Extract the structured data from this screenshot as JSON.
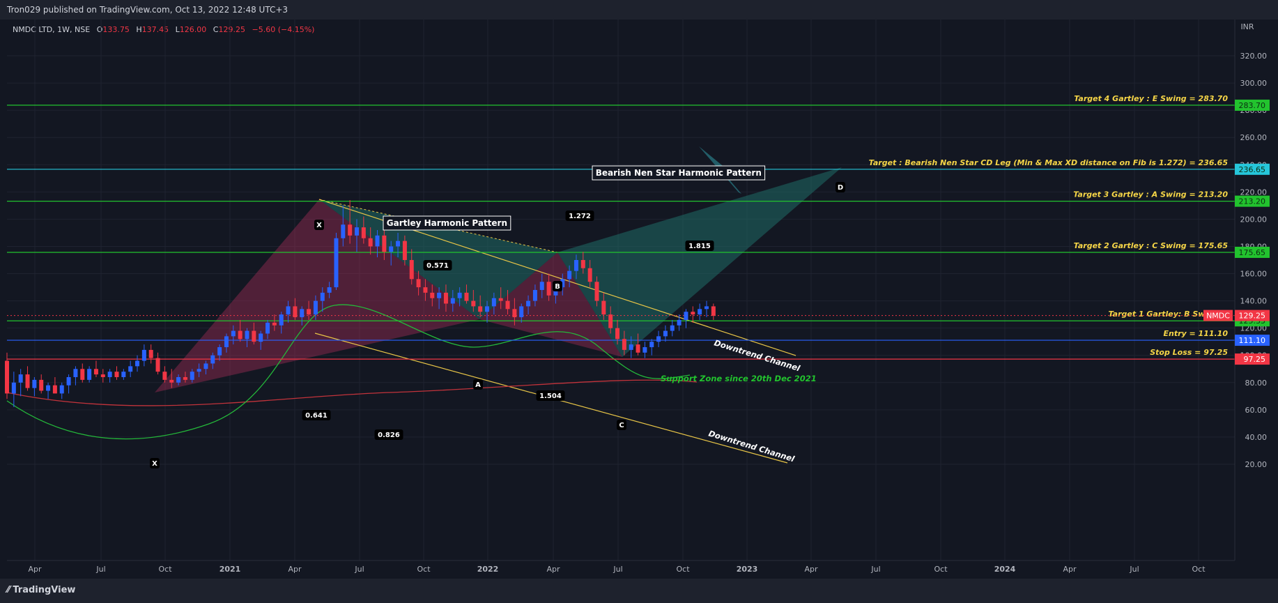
{
  "header": {
    "published_text": "Tron029 published on TradingView.com, Oct 13, 2022 12:48 UTC+3"
  },
  "footer": {
    "brand": "TradingView"
  },
  "symbol_bar": {
    "name": "NMDC LTD, 1W, NSE",
    "o_key": "O",
    "o": "133.75",
    "h_key": "H",
    "h": "137.45",
    "l_key": "L",
    "l": "126.00",
    "c_key": "C",
    "c": "129.25",
    "change": "−5.60 (−4.15%)"
  },
  "colors": {
    "up": "#2962ff",
    "down": "#f23645",
    "green_line": "#22c32e",
    "sma_green": "#24b83a",
    "sma_red": "#c2333b",
    "cyan": "#26c6da",
    "entry_blue": "#2962ff"
  },
  "chart_data": {
    "type": "candlestick",
    "currency": "INR",
    "y_ticks": [
      "320.00",
      "300.00",
      "280.00",
      "260.00",
      "240.00",
      "220.00",
      "200.00",
      "180.00",
      "160.00",
      "140.00",
      "120.00",
      "100.00",
      "80.00",
      "60.00",
      "40.00",
      "20.00"
    ],
    "x_ticks": [
      "Apr",
      "Jul",
      "Oct",
      "2021",
      "Apr",
      "Jul",
      "Oct",
      "2022",
      "Apr",
      "Jul",
      "Oct",
      "2023",
      "Apr",
      "Jul",
      "Oct",
      "2024",
      "Apr",
      "Jul",
      "Oct"
    ],
    "ylim": [
      8,
      340
    ],
    "horizontal_levels": [
      {
        "label": "Target 4 Gartley : E Swing = 283.70",
        "price": 283.7,
        "tag": "283.70",
        "color": "#22c32e"
      },
      {
        "label": "Target : Bearish Nen Star CD Leg (Min & Max XD distance on Fib is 1.272) = 236.65",
        "price": 236.65,
        "tag": "236.65",
        "color": "#26c6da"
      },
      {
        "label": "Target 3 Gartley : A Swing = 213.20",
        "price": 213.2,
        "tag": "213.20",
        "color": "#22c32e"
      },
      {
        "label": "Target 2 Gartley : C Swing = 175.65",
        "price": 175.65,
        "tag": "175.65",
        "color": "#22c32e"
      },
      {
        "label": "Target 1 Gartley: B Swing =",
        "price": 125.35,
        "tag": "125.35",
        "color": "#22c32e"
      },
      {
        "label": "Entry = 111.10",
        "price": 111.1,
        "tag": "111.10",
        "color": "#2962ff"
      },
      {
        "label": "Stop Loss = 97.25",
        "price": 97.25,
        "tag": "97.25",
        "color": "#f23645"
      }
    ],
    "last_price": {
      "symbol": "NMDC",
      "price": 129.25,
      "tag": "129.25"
    },
    "annotations": {
      "gartley_title": "Gartley Harmonic Pattern",
      "nenstar_title": "Bearish Nen Star Harmonic Pattern",
      "support_zone": "Support Zone since 20th Dec 2021",
      "channel_upper": "Downtrend Channel",
      "channel_lower": "Downtrend Channel",
      "points": [
        "X",
        "X",
        "A",
        "B",
        "C",
        "D"
      ],
      "fib_labels": [
        "0.571",
        "0.641",
        "0.826",
        "1.504",
        "1.272",
        "1.815"
      ]
    },
    "candles": [
      [
        96,
        102,
        68,
        72
      ],
      [
        72,
        88,
        62,
        80
      ],
      [
        80,
        90,
        70,
        86
      ],
      [
        86,
        92,
        74,
        76
      ],
      [
        76,
        84,
        70,
        82
      ],
      [
        82,
        86,
        72,
        74
      ],
      [
        74,
        80,
        68,
        78
      ],
      [
        78,
        84,
        72,
        72
      ],
      [
        72,
        80,
        68,
        78
      ],
      [
        78,
        86,
        72,
        84
      ],
      [
        84,
        92,
        78,
        90
      ],
      [
        90,
        94,
        80,
        82
      ],
      [
        82,
        92,
        80,
        90
      ],
      [
        90,
        96,
        84,
        86
      ],
      [
        86,
        90,
        80,
        84
      ],
      [
        84,
        90,
        80,
        88
      ],
      [
        88,
        92,
        82,
        84
      ],
      [
        84,
        90,
        82,
        88
      ],
      [
        88,
        96,
        84,
        92
      ],
      [
        92,
        100,
        88,
        96
      ],
      [
        96,
        108,
        92,
        104
      ],
      [
        104,
        108,
        94,
        98
      ],
      [
        98,
        102,
        86,
        88
      ],
      [
        88,
        92,
        80,
        82
      ],
      [
        82,
        90,
        76,
        80
      ],
      [
        80,
        86,
        78,
        84
      ],
      [
        84,
        88,
        80,
        82
      ],
      [
        82,
        90,
        80,
        88
      ],
      [
        88,
        94,
        84,
        90
      ],
      [
        90,
        96,
        86,
        94
      ],
      [
        94,
        102,
        90,
        100
      ],
      [
        100,
        108,
        96,
        106
      ],
      [
        106,
        116,
        102,
        114
      ],
      [
        114,
        122,
        108,
        118
      ],
      [
        118,
        126,
        110,
        112
      ],
      [
        112,
        120,
        106,
        118
      ],
      [
        118,
        124,
        108,
        110
      ],
      [
        110,
        118,
        104,
        116
      ],
      [
        116,
        126,
        112,
        124
      ],
      [
        124,
        130,
        118,
        122
      ],
      [
        122,
        132,
        116,
        130
      ],
      [
        130,
        140,
        124,
        136
      ],
      [
        136,
        142,
        126,
        128
      ],
      [
        128,
        136,
        122,
        134
      ],
      [
        134,
        140,
        126,
        130
      ],
      [
        130,
        144,
        126,
        140
      ],
      [
        140,
        150,
        132,
        146
      ],
      [
        146,
        154,
        142,
        150
      ],
      [
        150,
        190,
        148,
        186
      ],
      [
        186,
        210,
        180,
        196
      ],
      [
        196,
        214,
        182,
        188
      ],
      [
        188,
        200,
        176,
        194
      ],
      [
        194,
        202,
        182,
        186
      ],
      [
        186,
        194,
        174,
        180
      ],
      [
        180,
        192,
        172,
        188
      ],
      [
        188,
        194,
        170,
        176
      ],
      [
        176,
        184,
        166,
        180
      ],
      [
        180,
        190,
        172,
        184
      ],
      [
        184,
        188,
        166,
        170
      ],
      [
        170,
        178,
        152,
        156
      ],
      [
        156,
        162,
        144,
        150
      ],
      [
        150,
        156,
        140,
        146
      ],
      [
        146,
        152,
        136,
        142
      ],
      [
        142,
        150,
        134,
        146
      ],
      [
        146,
        152,
        132,
        138
      ],
      [
        138,
        148,
        132,
        142
      ],
      [
        142,
        150,
        136,
        146
      ],
      [
        146,
        152,
        138,
        140
      ],
      [
        140,
        148,
        132,
        136
      ],
      [
        136,
        144,
        128,
        132
      ],
      [
        132,
        140,
        124,
        136
      ],
      [
        136,
        146,
        130,
        142
      ],
      [
        142,
        150,
        134,
        140
      ],
      [
        140,
        148,
        130,
        134
      ],
      [
        134,
        142,
        122,
        128
      ],
      [
        128,
        138,
        124,
        136
      ],
      [
        136,
        144,
        130,
        140
      ],
      [
        140,
        152,
        136,
        148
      ],
      [
        148,
        160,
        142,
        154
      ],
      [
        154,
        160,
        140,
        144
      ],
      [
        144,
        154,
        138,
        150
      ],
      [
        150,
        160,
        144,
        156
      ],
      [
        156,
        166,
        150,
        162
      ],
      [
        162,
        174,
        156,
        170
      ],
      [
        170,
        176,
        160,
        164
      ],
      [
        164,
        170,
        150,
        154
      ],
      [
        154,
        158,
        136,
        140
      ],
      [
        140,
        146,
        126,
        130
      ],
      [
        130,
        136,
        116,
        120
      ],
      [
        120,
        126,
        108,
        112
      ],
      [
        112,
        118,
        100,
        104
      ],
      [
        104,
        114,
        98,
        108
      ],
      [
        108,
        116,
        100,
        102
      ],
      [
        102,
        110,
        98,
        106
      ],
      [
        106,
        112,
        100,
        110
      ],
      [
        110,
        118,
        106,
        114
      ],
      [
        114,
        122,
        110,
        118
      ],
      [
        118,
        126,
        114,
        122
      ],
      [
        122,
        130,
        118,
        126
      ],
      [
        126,
        134,
        120,
        132
      ],
      [
        132,
        136,
        124,
        130
      ],
      [
        130,
        138,
        126,
        134
      ],
      [
        134,
        140,
        128,
        136
      ],
      [
        136,
        138,
        126,
        129
      ]
    ],
    "x_domain_weeks": [
      0,
      220
    ]
  }
}
